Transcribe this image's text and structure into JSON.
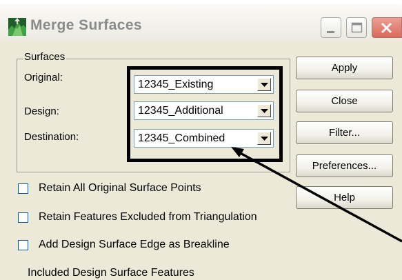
{
  "window": {
    "title": "Merge Surfaces",
    "icon": "terrain-app-icon",
    "controls": [
      "minimize-icon",
      "maximize-icon",
      "close-icon"
    ]
  },
  "surfaces": {
    "group_label": "Surfaces",
    "fields": [
      {
        "label": "Original:",
        "value": "12345_Existing"
      },
      {
        "label": "Design:",
        "value": "12345_Additional"
      },
      {
        "label": "Destination:",
        "value": "12345_Combined"
      }
    ]
  },
  "buttons": [
    "Apply",
    "Close",
    "Filter...",
    "Preferences...",
    "Help"
  ],
  "options": [
    {
      "label": "Retain All Original Surface Points",
      "checked": false
    },
    {
      "label": "Retain Features Excluded from Triangulation",
      "checked": false
    },
    {
      "label": "Add Design Surface Edge as Breakline",
      "checked": false
    }
  ],
  "partial_section_label": "Included Design Surface Features",
  "colors": {
    "dialog_bg": "#ece9d8",
    "title_text": "#8a8a8a",
    "close_button": "#d96a5c",
    "highlight": "#000000",
    "input_border": "#7f9db9"
  }
}
